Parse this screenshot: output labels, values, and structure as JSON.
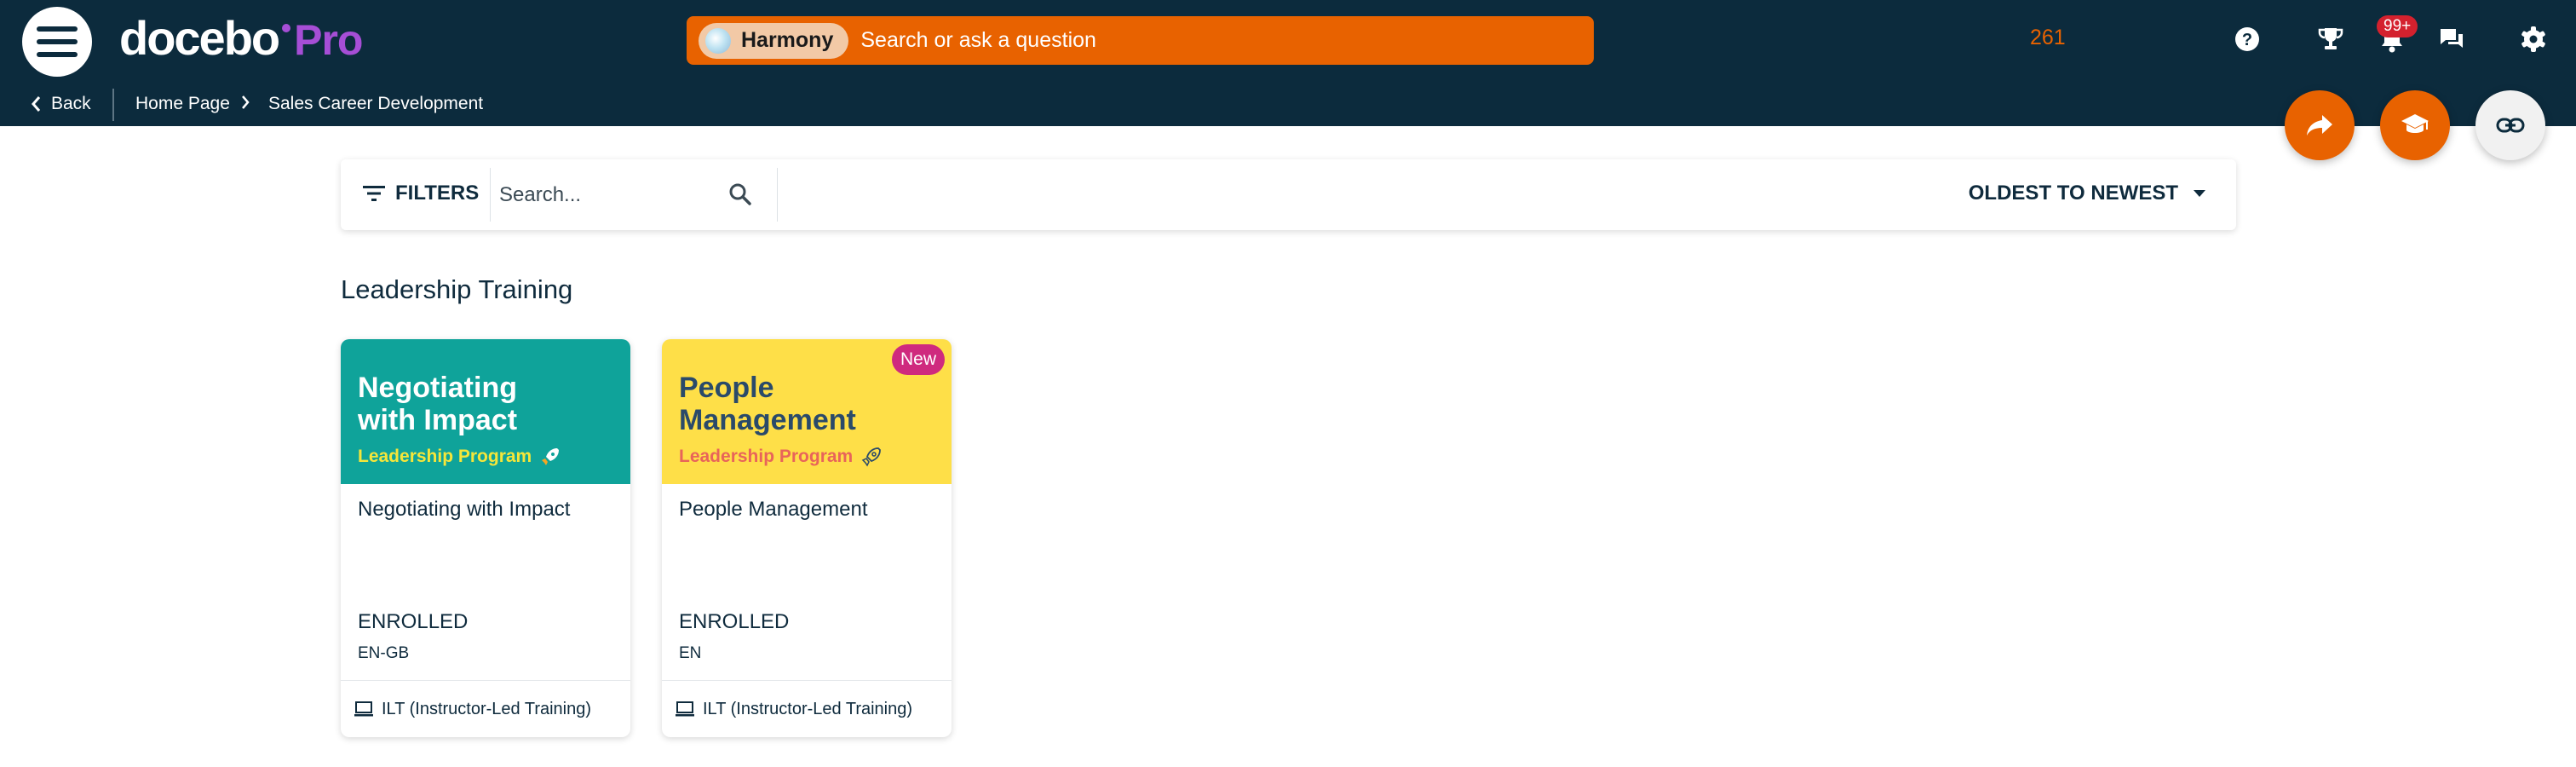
{
  "colors": {
    "header_bg": "#0c2b3d",
    "accent_orange": "#e86200",
    "brand_purple": "#a64ed6",
    "card1_thumb": "#0fa39a",
    "card2_thumb": "#fedf48",
    "new_badge": "#cf2a7e"
  },
  "header": {
    "brand_word": "docebo",
    "brand_tier": "Pro",
    "search": {
      "assistant_label": "Harmony",
      "placeholder": "Search or ask a question"
    },
    "points": "261",
    "notifications_badge": "99+",
    "icons": [
      "menu-icon",
      "help-icon",
      "trophy-icon",
      "bell-icon",
      "chat-icon",
      "gear-icon"
    ]
  },
  "breadcrumb": {
    "back_label": "Back",
    "items": [
      "Home Page",
      "Sales Career Development"
    ]
  },
  "fabs": [
    "share-icon",
    "graduation-cap-icon",
    "link-icon"
  ],
  "filter_bar": {
    "filters_label": "FILTERS",
    "search_placeholder": "Search...",
    "sort_label": "OLDEST TO NEWEST"
  },
  "section": {
    "title": "Leadership Training"
  },
  "cards": [
    {
      "thumb_title": "Negotiating with Impact",
      "thumb_title_lines": [
        "Negotiating",
        "with Impact"
      ],
      "thumb_subtitle": "Leadership Program",
      "name": "Negotiating with Impact",
      "status": "ENROLLED",
      "language": "EN-GB",
      "type": "ILT (Instructor-Led Training)",
      "is_new": false
    },
    {
      "thumb_title": "People Management",
      "thumb_title_lines": [
        "People",
        "Management"
      ],
      "thumb_subtitle": "Leadership Program",
      "name": "People Management",
      "status": "ENROLLED",
      "language": "EN",
      "type": "ILT (Instructor-Led Training)",
      "is_new": true,
      "badge": "New"
    }
  ]
}
